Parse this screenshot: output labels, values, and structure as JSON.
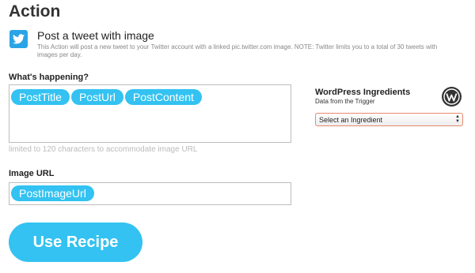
{
  "page": {
    "title": "Action"
  },
  "action": {
    "icon": "twitter-bird-icon",
    "name": "Post a tweet with image",
    "description": "This Action will post a new tweet to your Twitter account with a linked pic.twitter.com image. NOTE: Twitter limits you to a total of 30 tweets with images per day."
  },
  "whats_happening": {
    "label": "What's happening?",
    "tokens": [
      "PostTitle",
      "PostUrl",
      "PostContent"
    ],
    "hint": "limited to 120 characters to accommodate image URL"
  },
  "image_url": {
    "label": "Image URL",
    "tokens": [
      "PostImageUrl"
    ]
  },
  "ingredients": {
    "title": "WordPress Ingredients",
    "subtitle": "Data from the Trigger",
    "logo_icon": "wordpress-logo-icon",
    "select_value": "Select an Ingredient"
  },
  "cta": {
    "label": "Use Recipe"
  },
  "colors": {
    "accent": "#33c2f1",
    "twitter": "#2aa4e6",
    "select_border": "#e58a6c"
  }
}
